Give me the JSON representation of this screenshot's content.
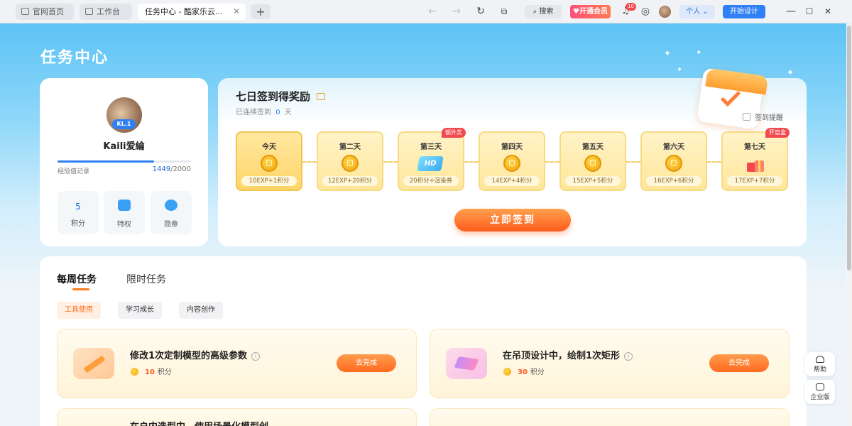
{
  "browser": {
    "tabs": [
      {
        "label": "官网首页"
      },
      {
        "label": "工作台"
      },
      {
        "label": "任务中心 - 酷家乐云...",
        "active": true
      }
    ],
    "search_label": "搜索",
    "vip_label": "开通会员",
    "notification_count": "10",
    "user_menu_label": "个人",
    "start_design_label": "开始设计"
  },
  "page_title": "任务中心",
  "profile": {
    "level": "KL.1",
    "username": "Kaili爱綸",
    "exp_label": "经验值记录",
    "exp_current": "1449",
    "exp_total": "/2000",
    "exp_progress": 0.7245,
    "stats": [
      {
        "value": "5",
        "label": "积分"
      },
      {
        "label": "特权",
        "icon": "gift-icon"
      },
      {
        "label": "勋章",
        "icon": "medal-icon"
      }
    ]
  },
  "signin": {
    "title": "七日签到得奖励",
    "streak_prefix": "已连续签到",
    "streak_days": "0",
    "streak_suffix": "天",
    "reminder_label": "签到提醒",
    "button_label": "立即签到",
    "days": [
      {
        "name": "今天",
        "reward": "10EXP+1积分"
      },
      {
        "name": "第二天",
        "reward": "12EXP+20积分"
      },
      {
        "name": "第三天",
        "reward": "20积分+渲染券",
        "badge": "额外奖"
      },
      {
        "name": "第四天",
        "reward": "14EXP+4积分"
      },
      {
        "name": "第五天",
        "reward": "15EXP+5积分"
      },
      {
        "name": "第六天",
        "reward": "16EXP+6积分"
      },
      {
        "name": "第七天",
        "reward": "17EXP+7积分",
        "badge": "开盲盒"
      }
    ],
    "hd_label": "HD"
  },
  "tasks": {
    "tabs": [
      "每周任务",
      "限时任务"
    ],
    "categories": [
      "工具使用",
      "学习成长",
      "内容创作"
    ],
    "items": [
      {
        "title": "修改1次定制模型的高级参数",
        "points": "10",
        "points_unit": "积分",
        "action": "去完成"
      },
      {
        "title": "在吊顶设计中，绘制1次矩形",
        "points": "30",
        "points_unit": "积分",
        "action": "去完成"
      },
      {
        "title": "在户内选型中，使用场景化模型创"
      }
    ]
  },
  "floating": {
    "help_label": "帮助",
    "enterprise_label": "企业版"
  },
  "colors": {
    "accent": "#ff6a14",
    "primary_blue": "#1f6ad6",
    "header_gradient_top": "#5cc3f5"
  }
}
